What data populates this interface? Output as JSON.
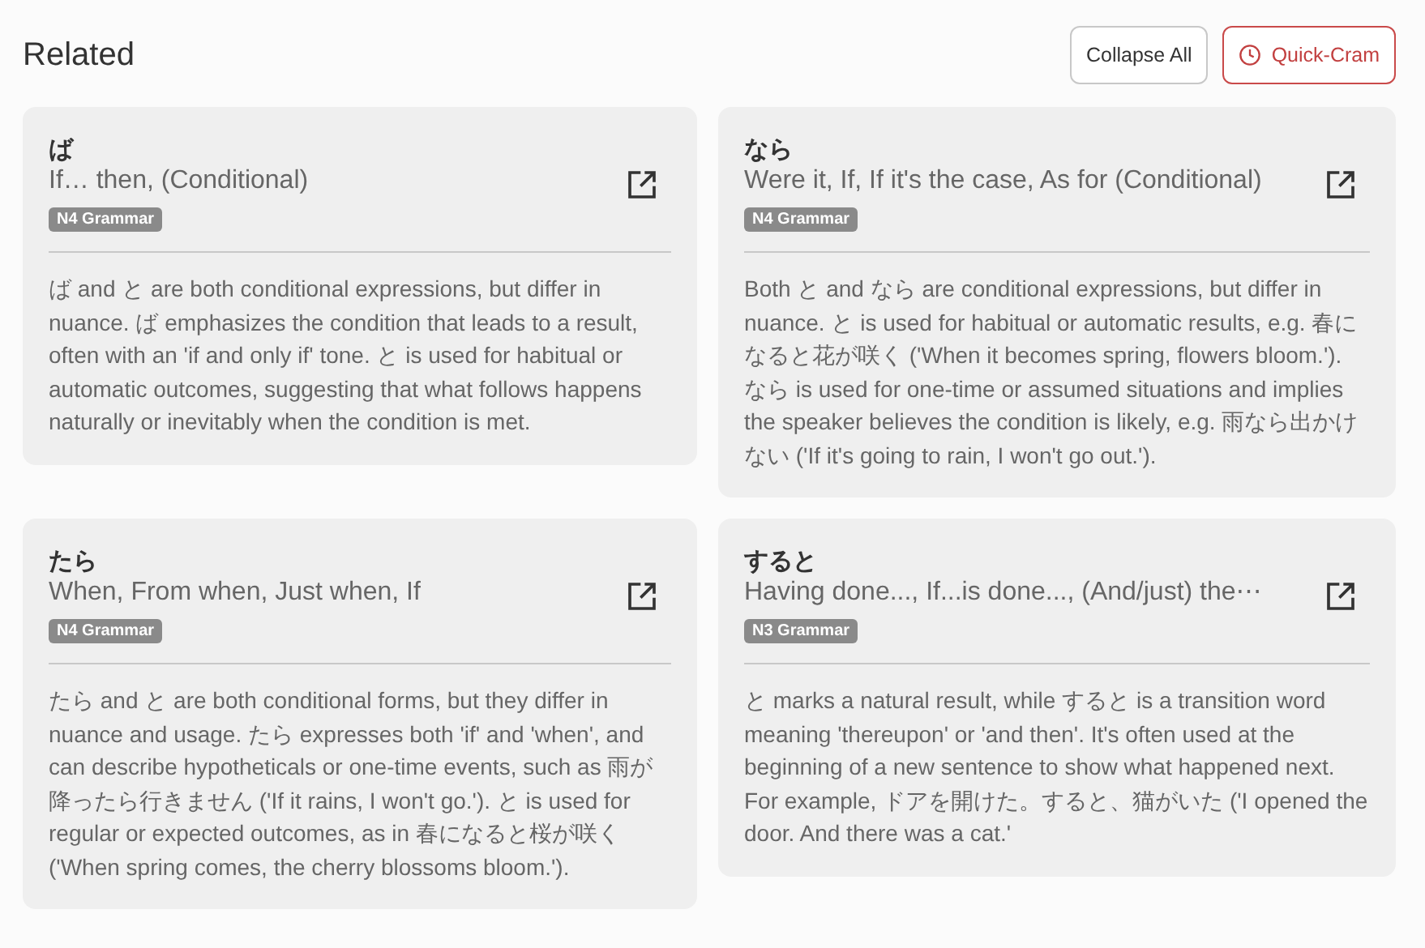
{
  "header": {
    "title": "Related",
    "buttons": [
      {
        "label": "Collapse All",
        "kind": "plain"
      },
      {
        "label": "Quick-Cram",
        "kind": "accent"
      }
    ]
  },
  "cards": [
    {
      "term": "ば",
      "meaning": "If… then, (Conditional)",
      "badge": "N4 Grammar",
      "body": "ば and と are both conditional expressions, but differ in nuance. ば emphasizes the condition that leads to a result, often with an 'if and only if' tone. と is used for habitual or automatic outcomes, suggesting that what follows happens naturally or inevitably when the condition is met."
    },
    {
      "term": "なら",
      "meaning": "Were it, If, If it's the case, As for (Conditional)",
      "badge": "N4 Grammar",
      "body": "Both と and なら are conditional expressions, but differ in nuance. と is used for habitual or automatic results, e.g. 春になると花が咲く ('When it becomes spring, flowers bloom.'). なら is used for one-time or assumed situations and implies the speaker believes the condition is likely, e.g. 雨なら出かけない ('If it's going to rain, I won't go out.')."
    },
    {
      "term": "たら",
      "meaning": "When, From when, Just when, If",
      "badge": "N4 Grammar",
      "body": "たら and と are both conditional forms, but they differ in nuance and usage. たら expresses both 'if' and 'when', and can describe hypotheticals or one-time events, such as 雨が降ったら行きません ('If it rains, I won't go.'). と is used for regular or expected outcomes, as in 春になると桜が咲く ('When spring comes, the cherry blossoms bloom.')."
    },
    {
      "term": "すると",
      "meaning": "Having done..., If...is done..., (And/just) the⋯",
      "badge": "N3 Grammar",
      "body": "と marks a natural result, while すると is a transition word meaning 'thereupon' or 'and then'. It's often used at the beginning of a new sentence to show what happened next. For example, ドアを開けた。すると、猫がいた ('I opened the door. And there was a cat.'"
    }
  ]
}
